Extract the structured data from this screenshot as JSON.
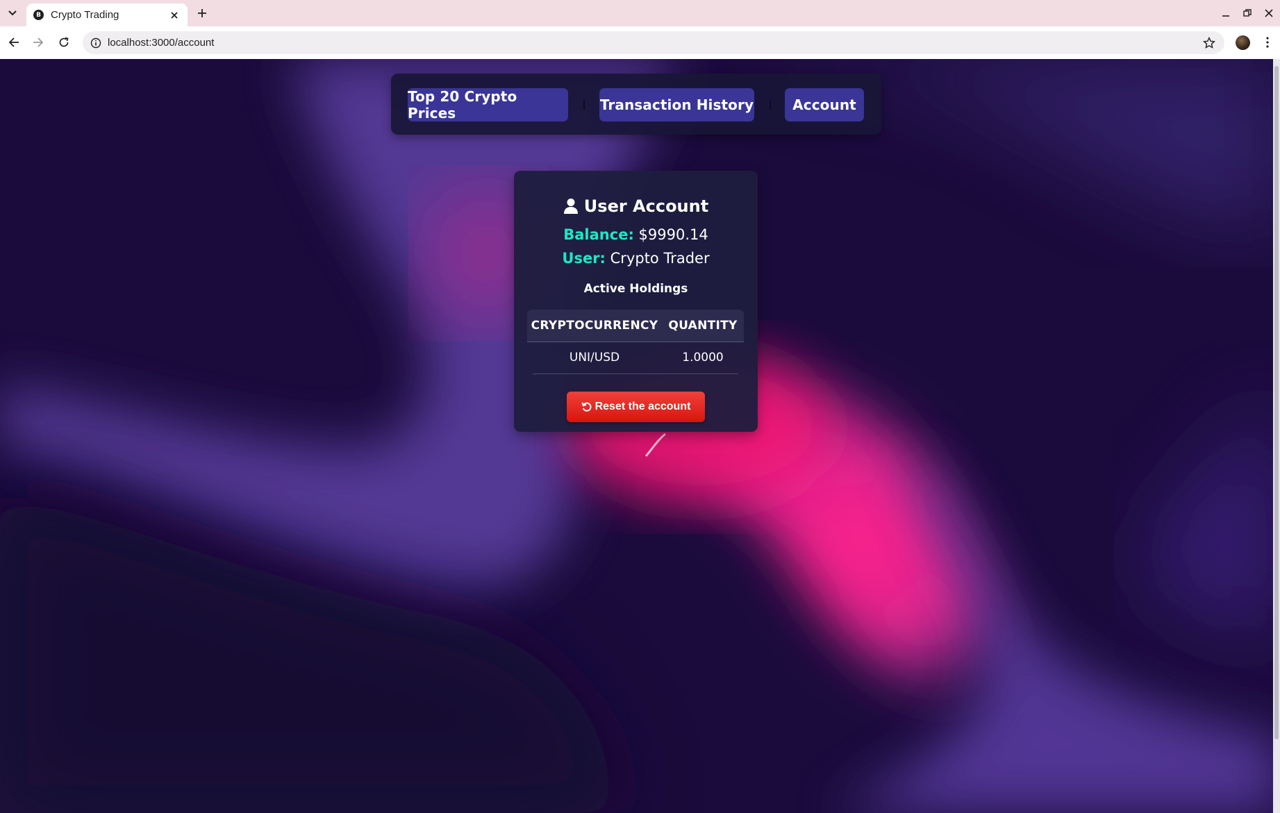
{
  "browser": {
    "tab_title": "Crypto Trading",
    "favicon_letter": "B",
    "url": "localhost:3000/account"
  },
  "nav": {
    "items": [
      {
        "label": "Top 20 Crypto Prices"
      },
      {
        "label": "Transaction History"
      },
      {
        "label": "Account"
      }
    ]
  },
  "account": {
    "title": "User Account",
    "balance_label": "Balance:",
    "balance_value": "$9990.14",
    "user_label": "User:",
    "user_value": "Crypto Trader",
    "holdings_title": "Active Holdings",
    "columns": [
      "CRYPTOCURRENCY",
      "QUANTITY"
    ],
    "rows": [
      {
        "crypto": "UNI/USD",
        "quantity": "1.0000"
      }
    ],
    "reset_label": "Reset the account"
  },
  "colors": {
    "accent": "#1de9c4",
    "nav_button": "#3a3596",
    "reset_button": "#e52a24",
    "card_bg": "#1e1e3e"
  },
  "icons": [
    "chevron-down-icon",
    "close-icon",
    "plus-icon",
    "minimize-icon",
    "restore-icon",
    "back-arrow-icon",
    "forward-arrow-icon",
    "reload-icon",
    "info-icon",
    "star-icon",
    "kebab-menu-icon",
    "user-icon",
    "undo-icon"
  ]
}
